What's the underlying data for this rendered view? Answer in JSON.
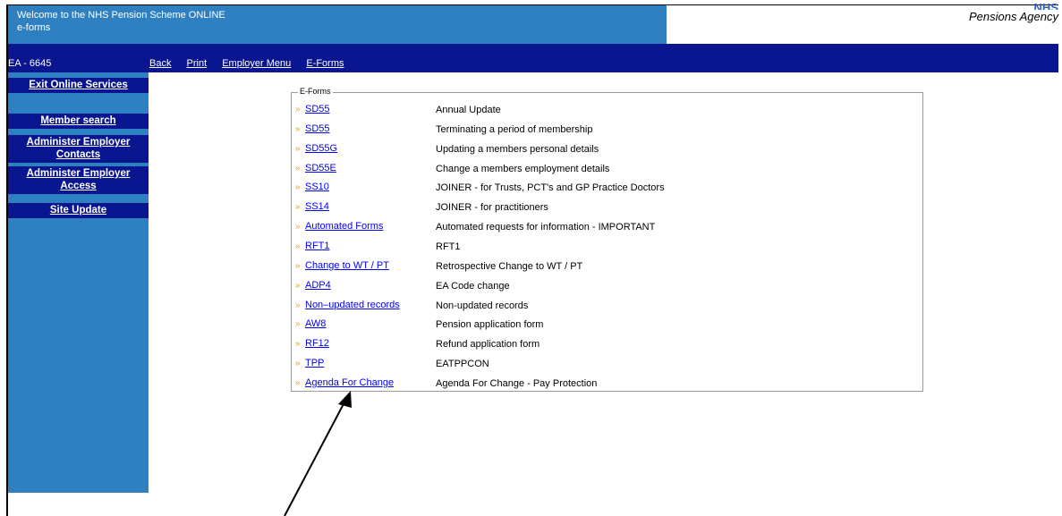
{
  "header": {
    "title": "Welcome to the NHS Pension Scheme ONLINE",
    "subtitle": "e-forms",
    "logo_nhs": "NHS",
    "logo_agency": "Pensions Agency"
  },
  "navbar": {
    "ea_code": "EA - 6645",
    "links": [
      "Back",
      "Print",
      "Employer Menu",
      "E-Forms"
    ]
  },
  "sidebar": {
    "buttons": [
      "Exit Online Services",
      "Member search",
      "Administer Employer Contacts",
      "Administer Employer Access",
      "Site Update"
    ]
  },
  "eforms": {
    "legend": "E-Forms",
    "bullet": "»",
    "rows": [
      {
        "link": "SD55",
        "desc": "Annual Update"
      },
      {
        "link": "SD55",
        "desc": "Terminating a period of membership"
      },
      {
        "link": "SD55G",
        "desc": "Updating a members personal details"
      },
      {
        "link": "SD55E",
        "desc": "Change a members employment details"
      },
      {
        "link": "SS10",
        "desc": "JOINER - for Trusts, PCT's and GP Practice Doctors"
      },
      {
        "link": "SS14",
        "desc": "JOINER - for practitioners"
      },
      {
        "link": "Automated Forms",
        "desc": "Automated requests for information - IMPORTANT"
      },
      {
        "link": "RFT1",
        "desc": "RFT1"
      },
      {
        "link": "Change to WT / PT",
        "desc": "Retrospective Change to WT / PT"
      },
      {
        "link": "ADP4",
        "desc": "EA Code change"
      },
      {
        "link": "Non–updated records",
        "desc": "Non-updated records"
      },
      {
        "link": "AW8",
        "desc": "Pension application form"
      },
      {
        "link": "RF12",
        "desc": "Refund application form"
      },
      {
        "link": "TPP",
        "desc": "EATPPCON"
      },
      {
        "link": "Agenda For Change",
        "desc": "Agenda For Change - Pay Protection"
      }
    ]
  },
  "colors": {
    "header_bg": "#2e80c1",
    "navbar_bg": "#0a168f",
    "link": "#0000ff",
    "bullet": "#e89b2a"
  }
}
